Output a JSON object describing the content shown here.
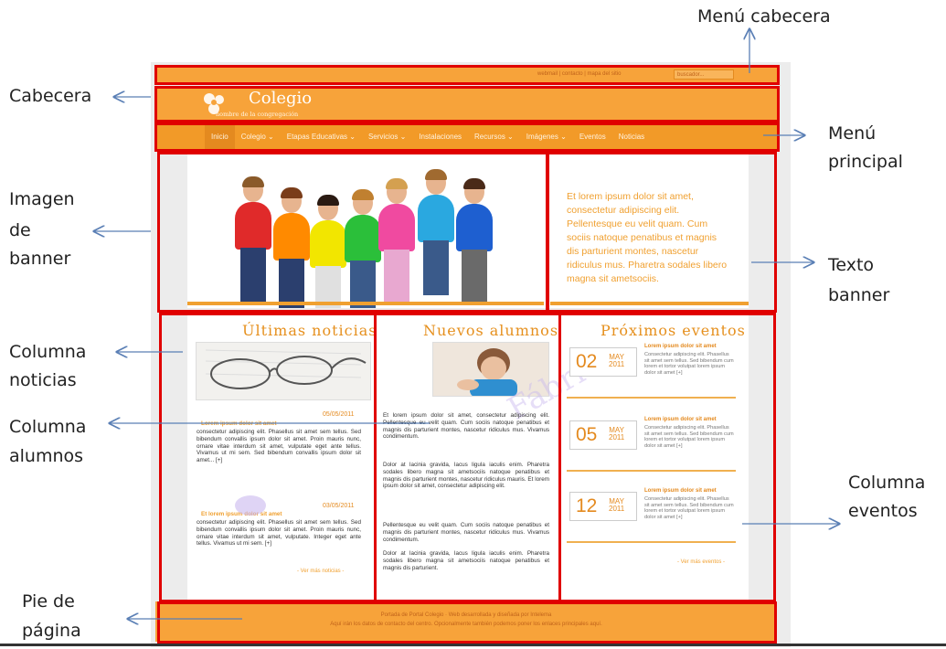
{
  "callouts": {
    "menu_cabecera": "Menú cabecera",
    "cabecera": "Cabecera",
    "menu_principal_1": "Menú",
    "menu_principal_2": "principal",
    "imagen_1": "Imagen",
    "imagen_2": "de",
    "imagen_3": "banner",
    "texto_1": "Texto",
    "texto_2": "banner",
    "noticias_1": "Columna",
    "noticias_2": "noticias",
    "alumnos_1": "Columna",
    "alumnos_2": "alumnos",
    "eventos_1": "Columna",
    "eventos_2": "eventos",
    "pie_1": "Pie de",
    "pie_2": "página"
  },
  "header": {
    "top_links": "webmail  |  contacto  |  mapa del sitio",
    "search_placeholder": "buscador...",
    "logo_title": "Colegio",
    "logo_subtitle": "nombre de la congregación"
  },
  "nav": [
    "Inicio",
    "Colegio ⌄",
    "Etapas Educativas ⌄",
    "Servicios ⌄",
    "Instalaciones",
    "Recursos ⌄",
    "Imágenes ⌄",
    "Eventos",
    "Noticias"
  ],
  "banner": {
    "text": "Et lorem ipsum dolor sit amet, consectetur adipiscing elit. Pellentesque eu velit quam. Cum sociis natoque penatibus et magnis dis parturient montes, nascetur ridiculus mus. Pharetra sodales libero magna sit ametsociis."
  },
  "noticias": {
    "title": "Últimas noticias",
    "item1_date": "05/05/2011",
    "item1_title": "Lorem ipsum dolor sit amet",
    "item1_text": "consectetur adipiscing elit. Phasellus sit amet sem tellus. Sed bibendum convallis ipsum dolor sit amet. Proin mauris nunc, ornare vitae interdum sit amet, vulputate eget ante tellus. Vivamus ut mi sem. Sed bibendum convallis ipsum dolor sit amet... [+]",
    "item2_date": "03/05/2011",
    "item2_title": "Et lorem ipsum dolor sit amet",
    "item2_text": "consectetur adipiscing elit. Phasellus sit amet sem tellus. Sed bibendum convallis ipsum dolor sit amet. Proin mauris nunc, ornare vitae interdum sit amet, vulputate. Integer eget ante tellus. Vivamus ut mi sem. [+]",
    "more": "- Ver más noticias -"
  },
  "alumnos": {
    "title": "Nuevos alumnos",
    "p1": "Et lorem ipsum dolor sit amet, consectetur adipiscing elit. Pellentesque eu velit quam. Cum sociis natoque penatibus et magnis dis parturient montes, nascetur ridiculus mus. Vivamus condimentum.",
    "p2": "Dolor at lacinia gravida, lacus ligula iaculis enim. Pharetra sodales libero magna sit ametsociis natoque penatibus et magnis dis parturient montes, nascetur ridiculus mauris. Et lorem ipsum dolor sit amet, consectetur adipiscing elit.",
    "p3": "Pellentesque eu velit quam. Cum sociis natoque penatibus et magnis dis parturient montes, nascetur ridiculus mus. Vivamus condimentum.",
    "p4": "Dolor at lacinia gravida, lacus ligula iaculis enim. Pharetra sodales libero magna sit ametsociis natoque penatibus et magnis dis parturient."
  },
  "eventos": {
    "title": "Próximos eventos",
    "items": [
      {
        "day": "02",
        "month": "MAY",
        "year": "2011",
        "title": "Lorem ipsum dolor sit amet",
        "text": "Consectetur adipiscing elit. Phasellus sit amet sem tellus. Sed bibendum cum lorem et tortor volutpat lorem ipsum dolor sit amet [+]"
      },
      {
        "day": "05",
        "month": "MAY",
        "year": "2011",
        "title": "Lorem ipsum dolor sit amet",
        "text": "Consectetur adipiscing elit. Phasellus sit amet sem tellus. Sed bibendum cum lorem et tortor volutpat lorem ipsum dolor sit amet [+]"
      },
      {
        "day": "12",
        "month": "MAY",
        "year": "2011",
        "title": "Lorem ipsum dolor sit amet",
        "text": "Consectetur adipiscing elit. Phasellus sit amet sem tellus. Sed bibendum cum lorem et tortor volutpat lorem ipsum dolor sit amet [+]"
      }
    ],
    "more": "- Ver más eventos -"
  },
  "footer": {
    "line1": "Portada de Portal Colegio · Web desarrollada y diseñada por Intelema",
    "line2": "Aquí irán los datos de contacto del centro. Opcionalmente también podemos poner los enlaces principales aquí."
  },
  "watermark": "Fábrica"
}
